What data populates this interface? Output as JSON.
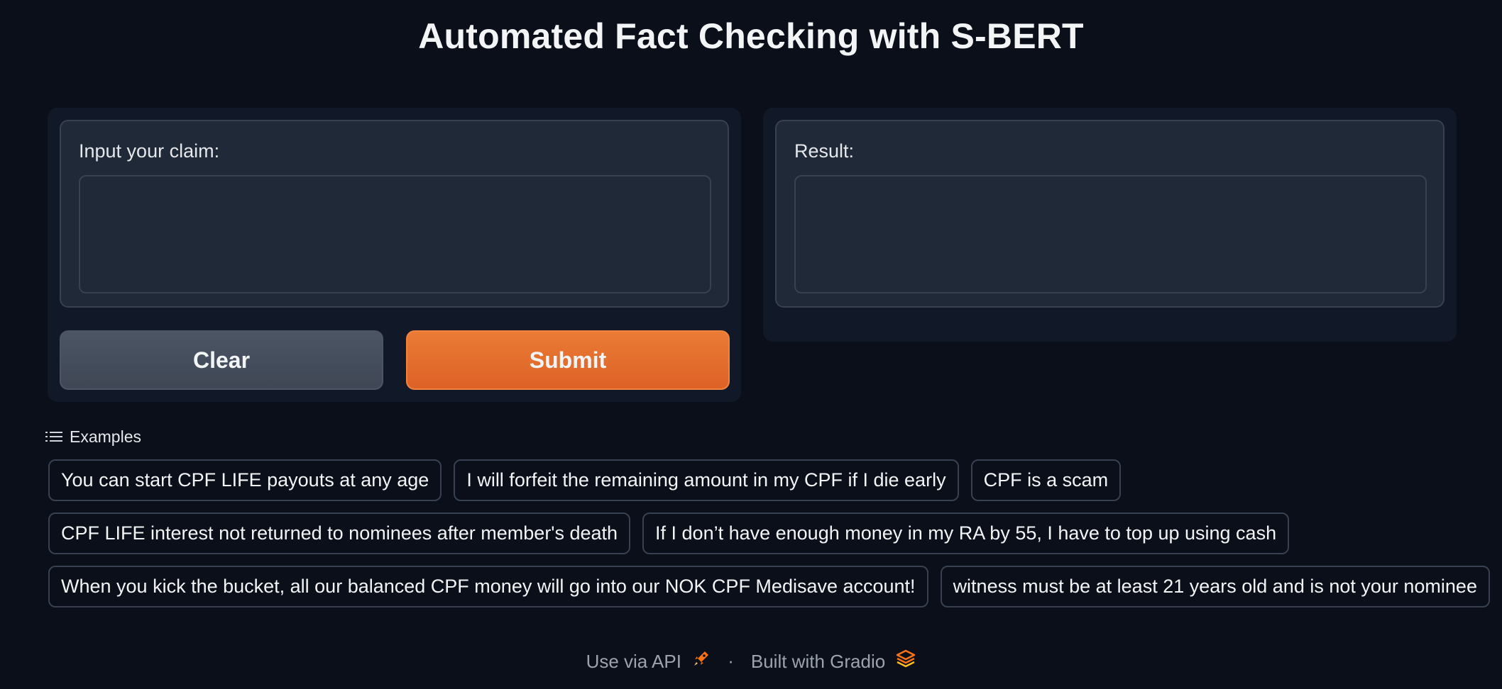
{
  "app": {
    "title": "Automated Fact Checking with S-BERT"
  },
  "input_panel": {
    "label": "Input your claim:",
    "value": "",
    "placeholder": ""
  },
  "result_panel": {
    "label": "Result:",
    "value": ""
  },
  "buttons": {
    "clear_label": "Clear",
    "submit_label": "Submit"
  },
  "examples": {
    "header": "Examples",
    "items": [
      "You can start CPF LIFE payouts at any age",
      "I will forfeit the remaining amount in my CPF if I die early",
      "CPF is a scam",
      "CPF LIFE interest not returned to nominees after member's death",
      "If I don’t have enough money in my RA by 55, I have to top up using cash",
      "When you kick the bucket, all our balanced CPF money will go into our NOK CPF Medisave account!",
      "witness must be at least 21 years old and is not your nominee"
    ]
  },
  "footer": {
    "api_label": "Use via API",
    "separator": "·",
    "built_label": "Built with Gradio",
    "api_icon": "rocket-icon",
    "gradio_icon": "gradio-logo-icon"
  },
  "colors": {
    "background": "#0b0f19",
    "panel": "#111827",
    "block": "#1f2937",
    "border": "#374151",
    "submit_accent": "#ea7b35",
    "clear_button": "#4b5563"
  }
}
